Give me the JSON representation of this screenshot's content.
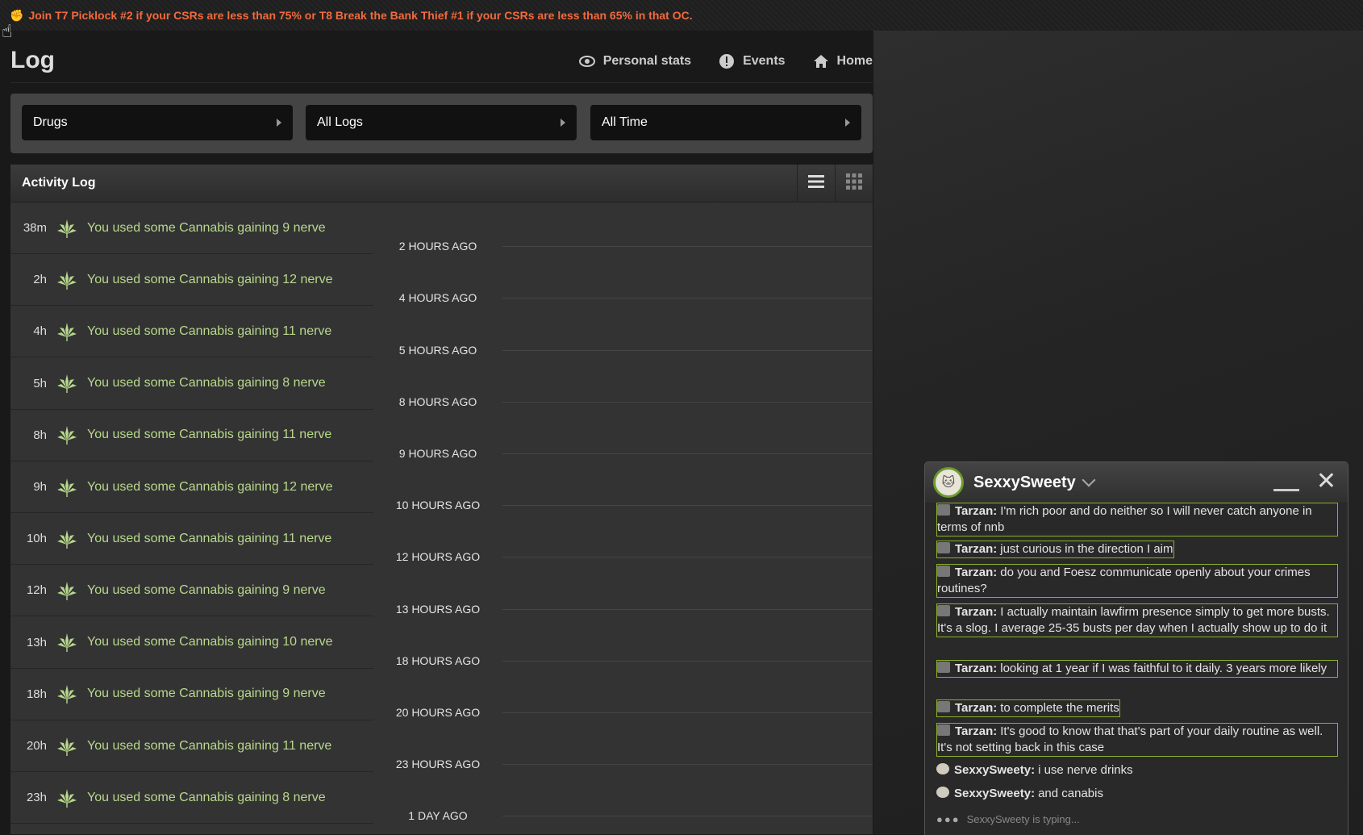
{
  "banner": {
    "text": "Join T7 Picklock #2 if your CSRs are less than 75% or T8 Break the Bank Thief #1 if your CSRs are less than 65% in that OC."
  },
  "header": {
    "title": "Log",
    "nav": [
      {
        "label": "Personal stats",
        "icon": "eye-icon"
      },
      {
        "label": "Events",
        "icon": "exclamation-icon"
      },
      {
        "label": "Home",
        "icon": "home-icon"
      }
    ]
  },
  "filters": [
    "Drugs",
    "All Logs",
    "All Time"
  ],
  "activity": {
    "title": "Activity Log",
    "entries": [
      {
        "age": "38m",
        "text": "You used some Cannabis gaining 9 nerve"
      },
      {
        "age": "2h",
        "text": "You used some Cannabis gaining 12 nerve"
      },
      {
        "age": "4h",
        "text": "You used some Cannabis gaining 11 nerve"
      },
      {
        "age": "5h",
        "text": "You used some Cannabis gaining 8 nerve"
      },
      {
        "age": "8h",
        "text": "You used some Cannabis gaining 11 nerve"
      },
      {
        "age": "9h",
        "text": "You used some Cannabis gaining 12 nerve"
      },
      {
        "age": "10h",
        "text": "You used some Cannabis gaining 11 nerve"
      },
      {
        "age": "12h",
        "text": "You used some Cannabis gaining 9 nerve"
      },
      {
        "age": "13h",
        "text": "You used some Cannabis gaining 10 nerve"
      },
      {
        "age": "18h",
        "text": "You used some Cannabis gaining 9 nerve"
      },
      {
        "age": "20h",
        "text": "You used some Cannabis gaining 11 nerve"
      },
      {
        "age": "23h",
        "text": "You used some Cannabis gaining 8 nerve"
      }
    ],
    "separators": [
      "2 HOURS AGO",
      "4 HOURS AGO",
      "5 HOURS AGO",
      "8 HOURS AGO",
      "9 HOURS AGO",
      "10 HOURS AGO",
      "12 HOURS AGO",
      "13 HOURS AGO",
      "18 HOURS AGO",
      "20 HOURS AGO",
      "23 HOURS AGO",
      "1 DAY AGO"
    ]
  },
  "chat": {
    "name": "SexxySweety",
    "messages": [
      {
        "who": "Tarzan:",
        "text": "I'm rich poor and do neither so I will never catch anyone in terms of nnb",
        "hl": true
      },
      {
        "who": "Tarzan:",
        "text": "just curious in the direction I aim",
        "hl": true
      },
      {
        "who": "Tarzan:",
        "text": "do you and Foesz communicate openly about your crimes routines?",
        "hl": true
      },
      {
        "who": "Tarzan:",
        "text": "I actually maintain lawfirm presence simply to get more busts. It's a slog. I average 25-35 busts per day when I actually show up to do it",
        "hl": true
      },
      {
        "who": "Tarzan:",
        "text": "looking at 1 year if I was faithful to it daily. 3 years more likely",
        "hl": true
      },
      {
        "who": "Tarzan:",
        "text": "to complete the merits",
        "hl": true
      },
      {
        "who": "Tarzan:",
        "text": "It's good to know that that's part of your daily routine as well. It's not setting back in this case",
        "hl": true
      },
      {
        "who": "SexxySweety:",
        "text": "i use nerve drinks",
        "hl": false
      },
      {
        "who": "SexxySweety:",
        "text": "and canabis",
        "hl": false
      }
    ],
    "typing": "SexxySweety is typing..."
  },
  "colors": {
    "banner": "#f26a3d",
    "entry": "#b8d88c",
    "accent": "#8ab02c"
  }
}
